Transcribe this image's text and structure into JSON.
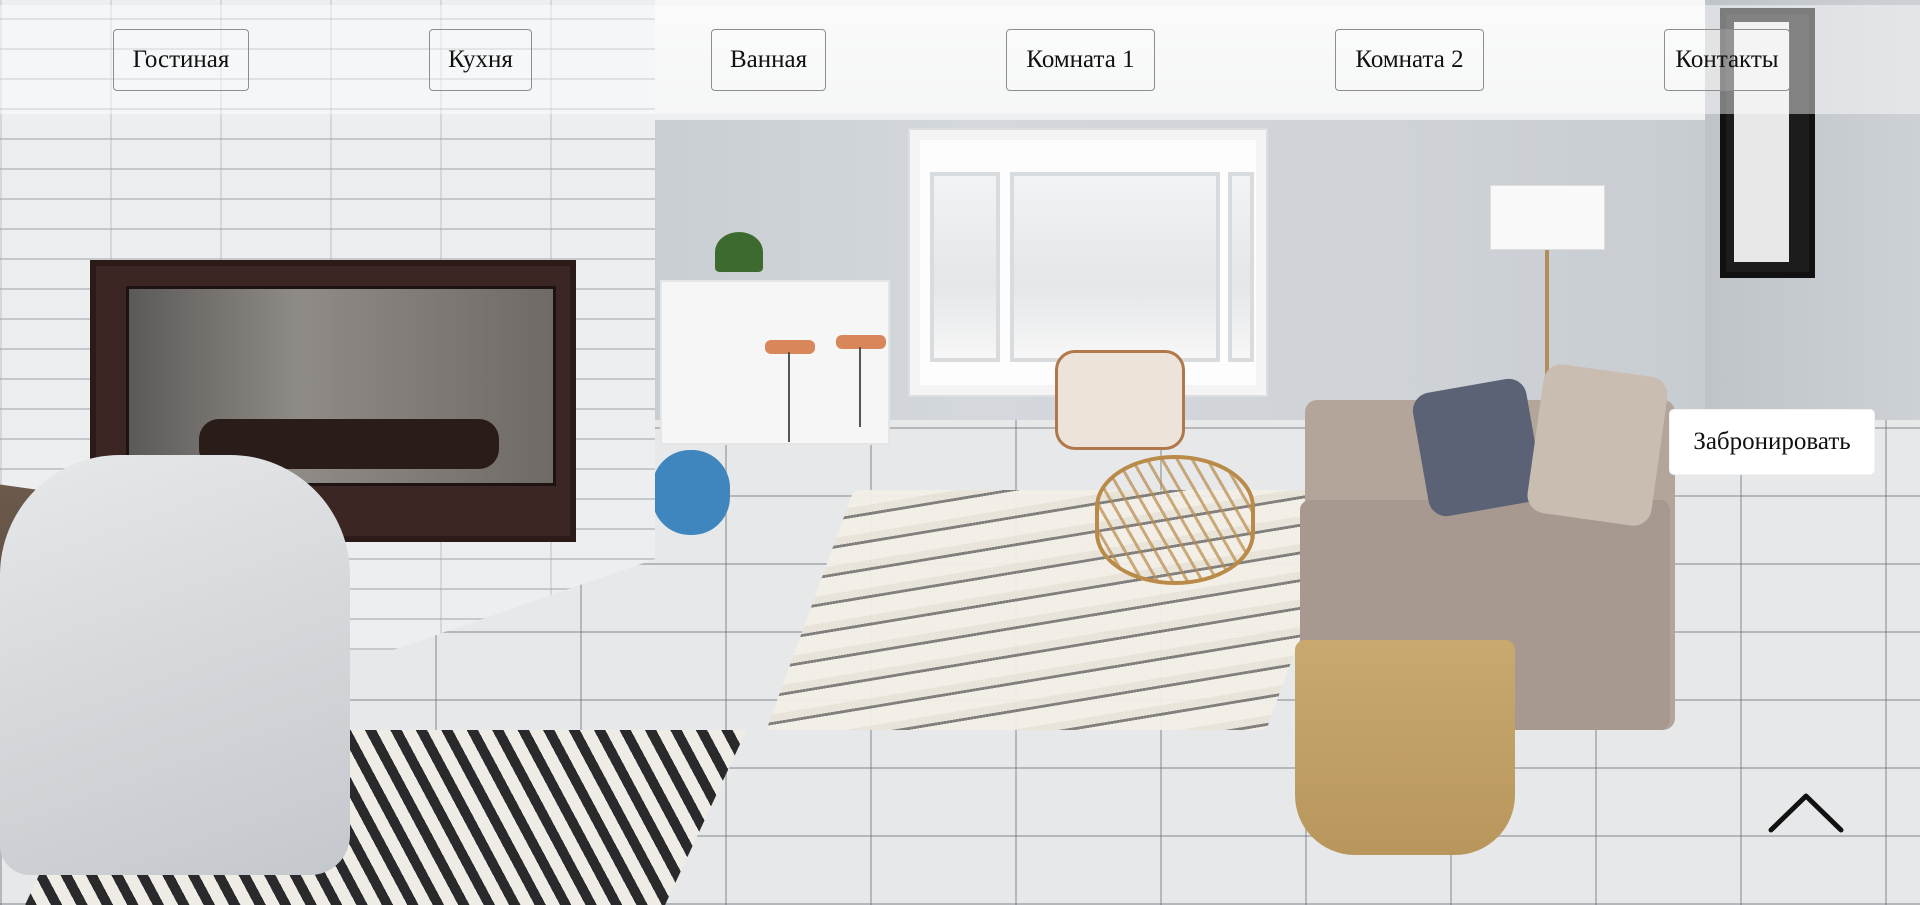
{
  "navigation": {
    "items": [
      {
        "label": "Гостиная"
      },
      {
        "label": "Кухня"
      },
      {
        "label": "Ванная"
      },
      {
        "label": "Комната 1"
      },
      {
        "label": "Комната 2"
      },
      {
        "label": "Контакты"
      }
    ]
  },
  "hero": {
    "image_icon": "living-room-photo",
    "book_label": "Забронировать"
  },
  "scroll_top": {
    "icon": "chevron-up-icon"
  },
  "colors": {
    "nav_overlay": "#ffffff",
    "nav_border": "#8e8e8e",
    "text": "#111111",
    "book_button_bg": "#ffffff"
  }
}
